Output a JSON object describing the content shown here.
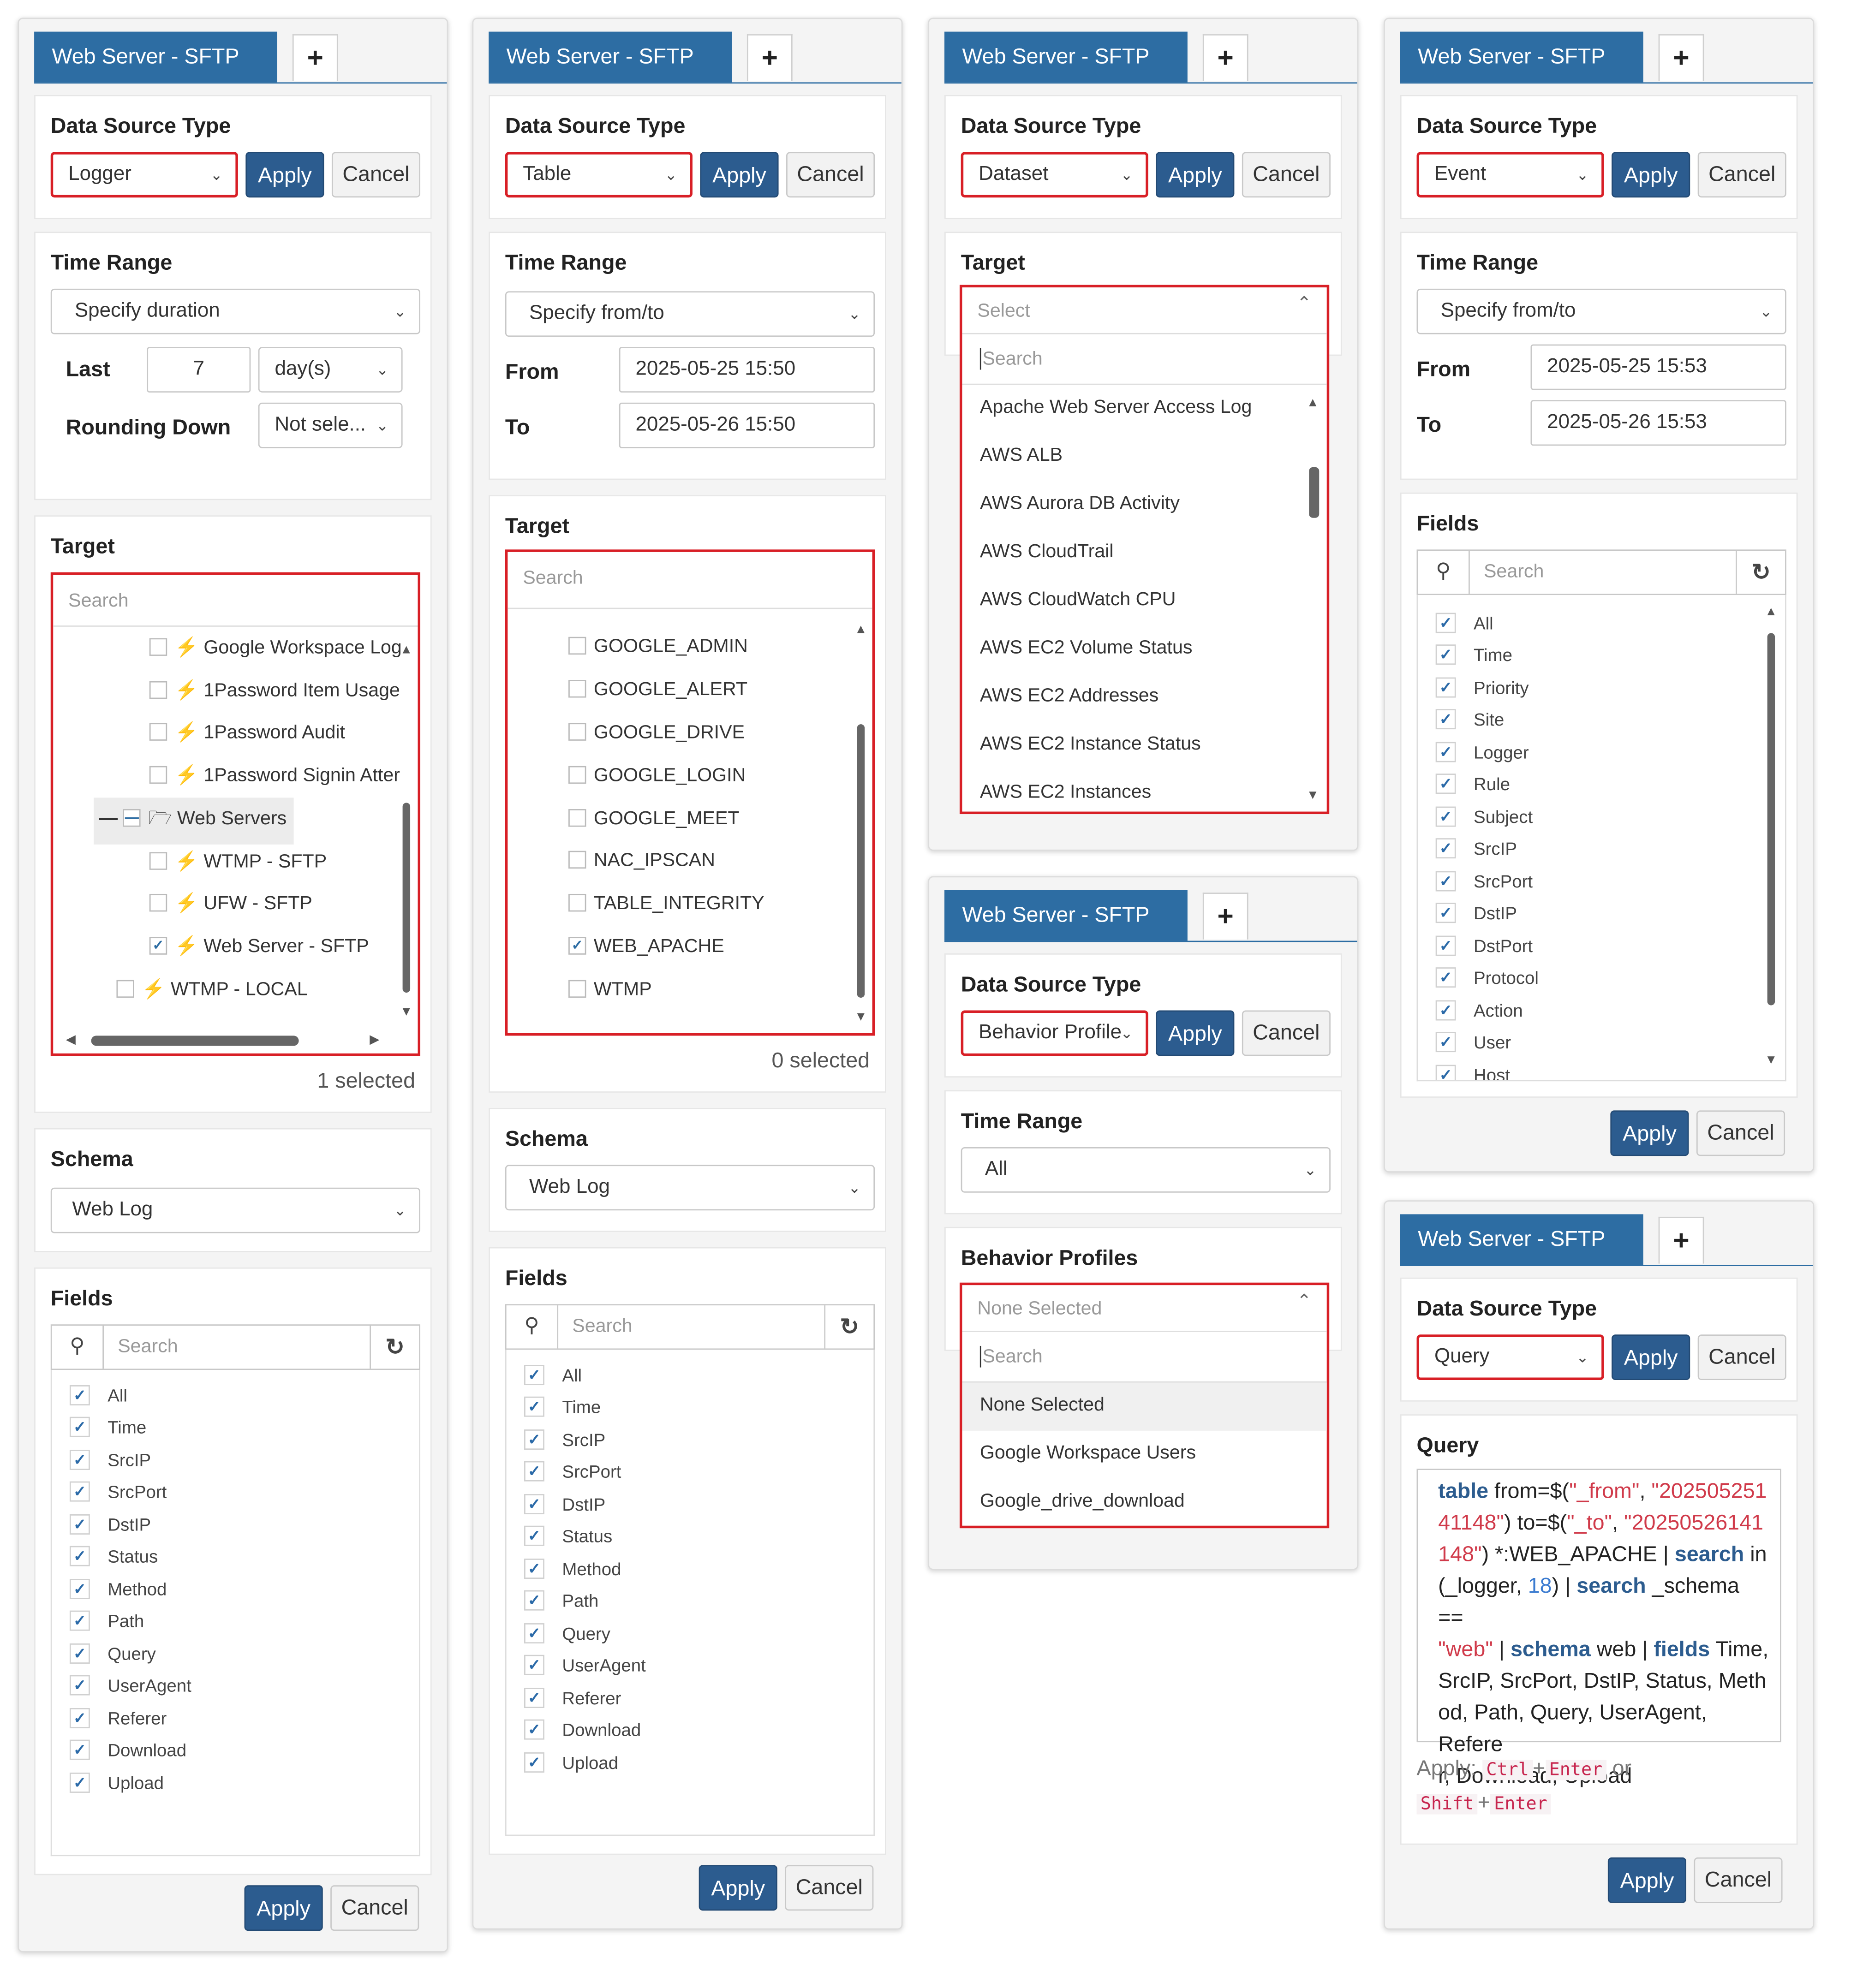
{
  "tab_title": "Web Server - SFTP",
  "plus_label": "+",
  "common": {
    "data_source_type": "Data Source Type",
    "apply": "Apply",
    "cancel": "Cancel",
    "time_range": "Time Range",
    "target": "Target",
    "schema": "Schema",
    "fields": "Fields",
    "search": "Search",
    "from": "From",
    "to": "To"
  },
  "panel1": {
    "source_type": "Logger",
    "time_range": "Specify duration",
    "last_label": "Last",
    "last_value": "7",
    "last_unit": "day(s)",
    "rounding_label": "Rounding Down",
    "rounding_value": "Not sele...",
    "target_items": [
      {
        "label": "Google Workspace Log",
        "checked": false
      },
      {
        "label": "1Password Item Usage",
        "checked": false
      },
      {
        "label": "1Password Audit",
        "checked": false
      },
      {
        "label": "1Password Signin Atter",
        "checked": false
      },
      {
        "label": "Web Servers",
        "folder": true
      },
      {
        "label": "WTMP - SFTP",
        "checked": false
      },
      {
        "label": "UFW - SFTP",
        "checked": false
      },
      {
        "label": "Web Server - SFTP",
        "checked": true
      },
      {
        "label": "WTMP - LOCAL",
        "checked": false
      }
    ],
    "selected_count": "1 selected",
    "schema": "Web Log",
    "fields": [
      "All",
      "Time",
      "SrcIP",
      "SrcPort",
      "DstIP",
      "Status",
      "Method",
      "Path",
      "Query",
      "UserAgent",
      "Referer",
      "Download",
      "Upload"
    ]
  },
  "panel2": {
    "source_type": "Table",
    "time_range": "Specify from/to",
    "from_value": "2025-05-25 15:50",
    "to_value": "2025-05-26 15:50",
    "target_items": [
      {
        "label": "GOOGLE_ADMIN",
        "checked": false
      },
      {
        "label": "GOOGLE_ALERT",
        "checked": false
      },
      {
        "label": "GOOGLE_DRIVE",
        "checked": false
      },
      {
        "label": "GOOGLE_LOGIN",
        "checked": false
      },
      {
        "label": "GOOGLE_MEET",
        "checked": false
      },
      {
        "label": "NAC_IPSCAN",
        "checked": false
      },
      {
        "label": "TABLE_INTEGRITY",
        "checked": false
      },
      {
        "label": "WEB_APACHE",
        "checked": true
      },
      {
        "label": "WTMP",
        "checked": false
      }
    ],
    "selected_count": "0 selected",
    "schema": "Web Log",
    "fields": [
      "All",
      "Time",
      "SrcIP",
      "SrcPort",
      "DstIP",
      "Status",
      "Method",
      "Path",
      "Query",
      "UserAgent",
      "Referer",
      "Download",
      "Upload"
    ]
  },
  "panel3": {
    "source_type": "Dataset",
    "target_placeholder": "Select",
    "dropdown_search": "Search",
    "items": [
      "Apache Web Server Access Log",
      "AWS ALB",
      "AWS Aurora DB Activity",
      "AWS CloudTrail",
      "AWS CloudWatch CPU",
      "AWS EC2 Volume Status",
      "AWS EC2 Addresses",
      "AWS EC2 Instance Status",
      "AWS EC2 Instances"
    ]
  },
  "panel4": {
    "source_type": "Behavior Profile",
    "time_range": "All",
    "profiles_title": "Behavior Profiles",
    "profiles_placeholder": "None Selected",
    "dropdown_search": "Search",
    "items": [
      "None Selected",
      "Google Workspace Users",
      "Google_drive_download"
    ]
  },
  "panel5": {
    "source_type": "Event",
    "time_range": "Specify from/to",
    "from_value": "2025-05-25 15:53",
    "to_value": "2025-05-26 15:53",
    "fields": [
      "All",
      "Time",
      "Priority",
      "Site",
      "Logger",
      "Rule",
      "Subject",
      "SrcIP",
      "SrcPort",
      "DstIP",
      "DstPort",
      "Protocol",
      "Action",
      "User",
      "Host"
    ]
  },
  "panel6": {
    "source_type": "Query",
    "query_title": "Query",
    "query_lines": [
      "table from=$(\"_from\", \"202505251",
      "41148\") to=$(\"_to\", \"20250526141",
      "148\") *:WEB_APACHE | search in",
      "(_logger, 18) | search _schema ==",
      "\"web\" | schema web | fields Time,",
      "SrcIP, SrcPort, DstIP, Status, Meth",
      "od, Path, Query, UserAgent, Refere",
      "r, Download, Upload"
    ],
    "hint_prefix": "Apply:",
    "key_ctrl": "Ctrl",
    "key_enter": "Enter",
    "key_shift": "Shift",
    "hint_or": "or",
    "hint_plus": "+"
  },
  "colors": {
    "accent": "#2d6da3",
    "highlight": "#d81f26",
    "button": "#2c5c8f"
  }
}
